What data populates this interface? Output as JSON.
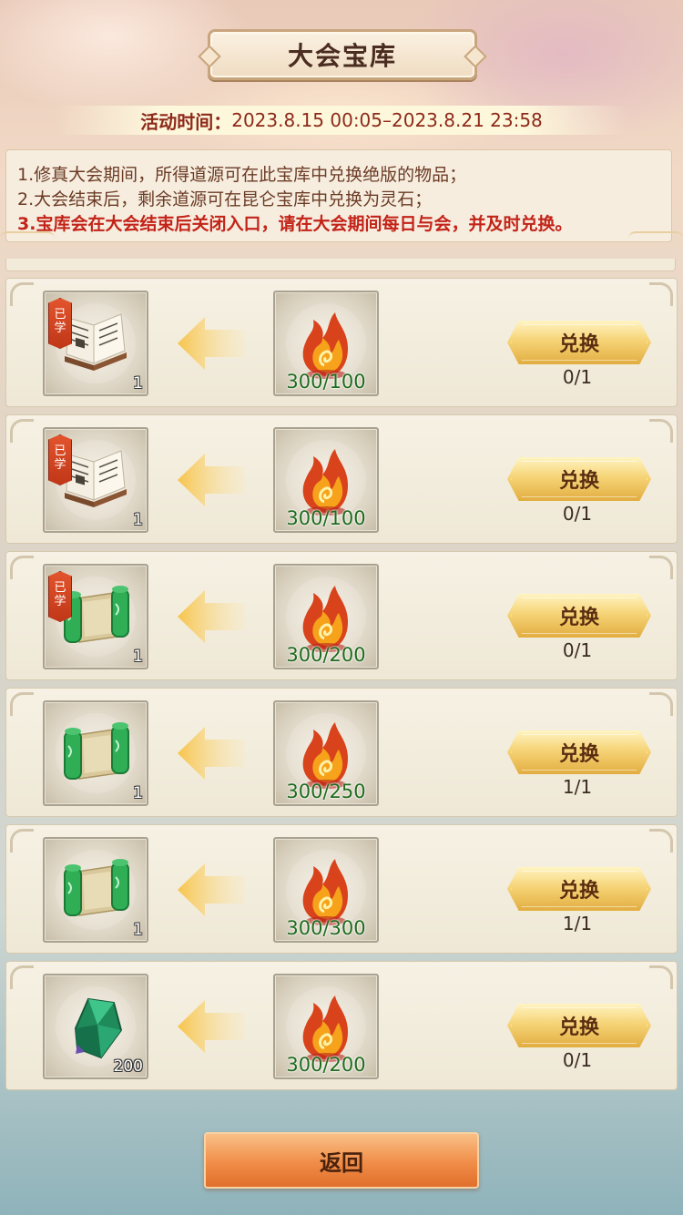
{
  "page": {
    "title": "大会宝库",
    "time_label": "活动时间：",
    "time_range": "2023.8.15 00:05–2023.8.21 23:58",
    "notices": [
      "1.修真大会期间，所得道源可在此宝库中兑换绝版的物品；",
      "2.大会结束后，剩余道源可在昆仑宝库中兑换为灵石；",
      "3.宝库会在大会结束后关闭入口，请在大会期间每日与会，并及时兑换。"
    ],
    "back_label": "返回"
  },
  "rows": [
    {
      "reward_icon": "skill-book-icon",
      "learned": true,
      "learned_label": "已学",
      "reward_count": "1",
      "cost_icon": "flame-currency-icon",
      "cost": "300/100",
      "button": "兑换",
      "limit": "0/1"
    },
    {
      "reward_icon": "skill-book-icon",
      "learned": true,
      "learned_label": "已学",
      "reward_count": "1",
      "cost_icon": "flame-currency-icon",
      "cost": "300/100",
      "button": "兑换",
      "limit": "0/1"
    },
    {
      "reward_icon": "jade-scroll-icon",
      "learned": true,
      "learned_label": "已学",
      "reward_count": "1",
      "cost_icon": "flame-currency-icon",
      "cost": "300/200",
      "button": "兑换",
      "limit": "0/1"
    },
    {
      "reward_icon": "jade-scroll-icon",
      "learned": false,
      "learned_label": "",
      "reward_count": "1",
      "cost_icon": "flame-currency-icon",
      "cost": "300/250",
      "button": "兑换",
      "limit": "1/1"
    },
    {
      "reward_icon": "jade-scroll-icon",
      "learned": false,
      "learned_label": "",
      "reward_count": "1",
      "cost_icon": "flame-currency-icon",
      "cost": "300/300",
      "button": "兑换",
      "limit": "1/1"
    },
    {
      "reward_icon": "green-spirit-stone-icon",
      "learned": false,
      "learned_label": "",
      "reward_count": "200",
      "cost_icon": "flame-currency-icon",
      "cost": "300/200",
      "button": "兑换",
      "limit": "0/1"
    }
  ],
  "colors": {
    "warning_text": "#c32318",
    "cost_text": "#1f6b1d",
    "button_gold": "#f6d477",
    "back_orange": "#f08d48"
  }
}
